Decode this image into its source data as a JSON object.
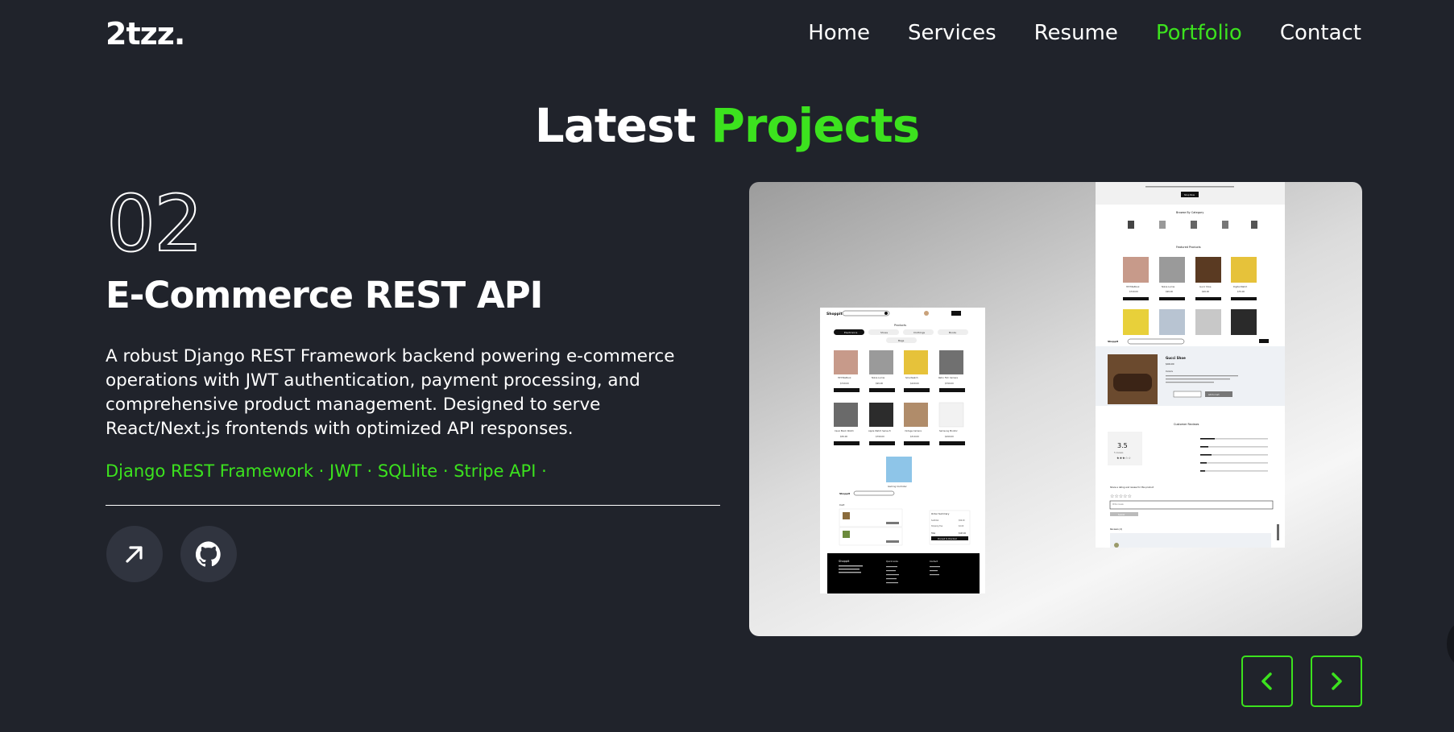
{
  "header": {
    "logo": "2tzz.",
    "nav": [
      {
        "label": "Home"
      },
      {
        "label": "Services"
      },
      {
        "label": "Resume"
      },
      {
        "label": "Portfolio",
        "active": true
      },
      {
        "label": "Contact"
      }
    ]
  },
  "section": {
    "title_part1": "Latest",
    "title_part2": "Projects"
  },
  "project": {
    "number": "02",
    "title": "E-Commerce REST API",
    "description": "A robust Django REST Framework backend powering e-commerce operations with JWT authentication, payment processing, and comprehensive product management. Designed to serve React/Next.js frontends with optimized API responses.",
    "stack": "Django REST Framework · JWT · SQLlite · Stripe API ·",
    "links": [
      {
        "icon": "arrow-up-right-icon"
      },
      {
        "icon": "github-icon"
      }
    ]
  },
  "screenshot": {
    "left": {
      "brand": "Shoppit",
      "section": "Products",
      "categories": [
        "Electronics",
        "Shoes",
        "Clothings",
        "Books",
        "Bags"
      ],
      "products": [
        {
          "name": "HP EliteBook",
          "price": "$749.00"
        },
        {
          "name": "Nokia Lumia",
          "price": "$99.00"
        },
        {
          "name": "Smartwatch",
          "price": "$249.00"
        },
        {
          "name": "Retro Film Camera",
          "price": "$799.00"
        },
        {
          "name": "Casio Black Watch",
          "price": "$59.00"
        },
        {
          "name": "Apple Watch Series 8",
          "price": "$799.00"
        },
        {
          "name": "Vintage Camera",
          "price": "$319.00"
        },
        {
          "name": "Samsung Monitor",
          "price": "$299.00"
        }
      ],
      "buy_label": "Buy Now",
      "extra_product": "Gaming Controller",
      "cart_title": "Cart",
      "order_summary": "Order Summary",
      "summary_lines": [
        {
          "label": "Subtotal",
          "value": "$99.00"
        },
        {
          "label": "Shipping Fee",
          "value": "$4.00"
        },
        {
          "label": "Total",
          "value": "$103.00"
        }
      ],
      "checkout": "Proceed to Checkout",
      "footer": {
        "brand": "Shoppit",
        "links_title": "Quick Links",
        "contact_title": "Contact"
      }
    },
    "right": {
      "shop_now": "Shop Now",
      "browse_title": "Browse By Category",
      "categories": [
        "Electronics",
        "Shoes",
        "Clothings",
        "Books",
        "Bags"
      ],
      "featured_title": "Featured Products",
      "featured": [
        {
          "name": "HP EliteBook",
          "price": "$749.00"
        },
        {
          "name": "Nokia Lumia",
          "price": "$99.00"
        },
        {
          "name": "Gucci Shoe",
          "price": "$99.00"
        },
        {
          "name": "Digital Watch",
          "price": "$79.00"
        }
      ],
      "product_name": "Gucci Shoe",
      "product_price": "$99.00",
      "product_meta": "Details",
      "add_cart": "Add to Cart",
      "reviews_title": "Customer Reviews",
      "rating": "3.5",
      "rating_sub": "5 reviews",
      "review_prompt": "Share a rating and review for this product",
      "review_placeholder": "Write review",
      "submit": "Submit",
      "reviews_label": "Reviews (4)"
    }
  },
  "controls": {
    "prev_icon": "chevron-left-icon",
    "next_icon": "chevron-right-icon"
  },
  "colors": {
    "background": "#20232b",
    "accent": "#3ce21e",
    "button_bg": "#30343f"
  }
}
